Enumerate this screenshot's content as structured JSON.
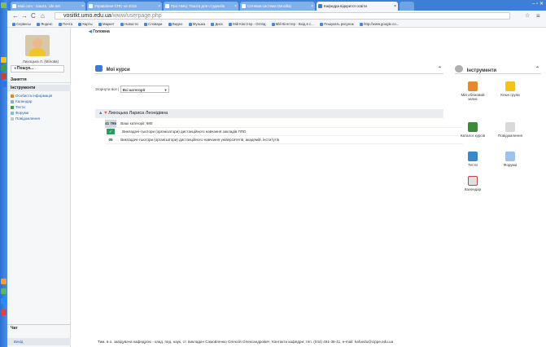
{
  "browser": {
    "tabs": [
      {
        "label": "Mail.com - пошта, Ukr.net"
      },
      {
        "label": "Управління СПС на 2016"
      },
      {
        "label": "Про НМЦ: Пошта для студентів"
      },
      {
        "label": "Сетевая система (Mozilla)"
      },
      {
        "label": "Кафедра відкритої освіти"
      }
    ],
    "url_host": "vositkt.umo.edu.ua",
    "url_path": "/www/userpage.php",
    "bookmarks": [
      "Сервисы",
      "Яндекс",
      "Почта",
      "Карты",
      "Маркет",
      "Новости",
      "Словари",
      "Видео",
      "Музыка",
      "Диск",
      "Мій Кінгстер - Огляд",
      "Мій Кінгстер - Вхід в с...",
      "Пошукать рисунок",
      "http://www.google.co..."
    ]
  },
  "breadcrumb": {
    "home": "Головна"
  },
  "sidebar": {
    "user_name": "Лихоцька Л. (Мілова)",
    "search_label": "Пошук...",
    "section_links": "Заняття",
    "section_tools": "Інструменти",
    "items": [
      {
        "label": "Особиста інформація"
      },
      {
        "label": "Календар"
      },
      {
        "label": "Тести"
      },
      {
        "label": "Форуми"
      },
      {
        "label": "Повідомлення"
      }
    ],
    "chat_label": "Чат",
    "bottom_label": "Вихід"
  },
  "courses": {
    "title": "Мої курси",
    "filter_label": "Згорнути все |",
    "filter_value": "Всі категорії",
    "teacher": "Лихоцька Лариса Леонідівна",
    "rows": [
      {
        "code": "41 765",
        "text": "Ваші категорії: 980"
      },
      {
        "code": "",
        "text": "Викладачі-тьютори (організатори) дистанційного навчання закладів ППО"
      },
      {
        "code": "05",
        "text": "Викладачі-тьютори (організатори) дистанційного навчання університетів, академій, інститутів"
      }
    ]
  },
  "tools": {
    "title": "Інструменти",
    "items": [
      {
        "label": "Мій обліковий запис"
      },
      {
        "label": "Ключ групи"
      },
      {
        "label": "Каталог курсів"
      },
      {
        "label": "Повідомлення"
      },
      {
        "label": "Тести"
      },
      {
        "label": "Форуми"
      },
      {
        "label": "Календар"
      }
    ]
  },
  "footer": {
    "text": "Тим. в.о. завідувача кафедрою - канд. пед. наук, ст. викладач Самойленко Олексій Олександрович. Контакти кафедри: тел. (044) 481-38-41, e-mail: kafoedu@cippe.edu.ua"
  }
}
